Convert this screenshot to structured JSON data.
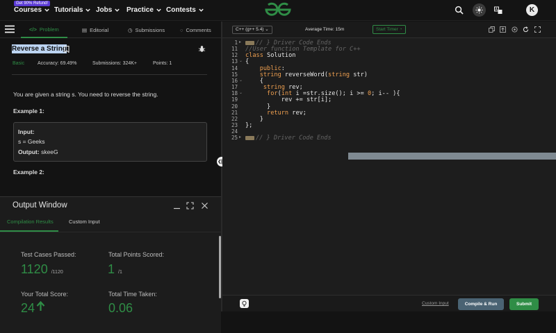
{
  "topnav": {
    "promo": "Get 90% Refund!",
    "items": [
      "Courses",
      "Tutorials",
      "Jobs",
      "Practice",
      "Contests"
    ],
    "avatar": "K"
  },
  "problem": {
    "tabs": [
      "Problem",
      "Editorial",
      "Submissions",
      "Comments"
    ],
    "title": "Reverse a String",
    "difficulty": "Basic",
    "accuracy": "Accuracy: 69.49%",
    "submissions": "Submissions: 324K+",
    "points": "Points: 1",
    "description": "You are given a string s. You need to reverse the string.",
    "example1_label": "Example 1:",
    "example1": {
      "input_label": "Input:",
      "input_value": "s  =  Geeks",
      "output_label": "Output:",
      "output_value": "skeeG"
    },
    "example2_label": "Example 2:"
  },
  "output": {
    "title": "Output Window",
    "tabs": [
      "Compilation Results",
      "Custom Input"
    ],
    "stats": {
      "tests_label": "Test Cases Passed:",
      "tests_value": "1120",
      "tests_total": "/1120",
      "points_label": "Total Points Scored:",
      "points_value": "1",
      "points_total": "/1",
      "score_label": "Your Total Score:",
      "score_value": "24",
      "time_label": "Total Time Taken:",
      "time_value": "0.06"
    }
  },
  "editor": {
    "language": "C++ (g++ 5.4)",
    "avg_time": "Average Time: 15m",
    "timer": "Start Timer",
    "line_numbers": [
      "1",
      "11",
      "12",
      "13",
      "14",
      "15",
      "16",
      "17",
      "18",
      "19",
      "20",
      "21",
      "22",
      "23",
      "24",
      "25"
    ],
    "lines": [
      "// } Driver Code Ends",
      "//User function Template for C++",
      "class Solution",
      "{",
      "    public:",
      "    string reverseWord(string str)",
      "    {",
      "     string rev;",
      "      for(int i =str.size(); i >= 0; i-- ){",
      "          rev += str[i];",
      "      }",
      "      return rev;",
      "    }",
      "};",
      "",
      "// } Driver Code Ends"
    ],
    "custom_input": "Custom Input",
    "compile_run": "Compile & Run",
    "submit": "Submit"
  },
  "colors": {
    "accent": "#2f8d46",
    "bg": "#131313",
    "editor_bg": "#1d1d1d"
  }
}
